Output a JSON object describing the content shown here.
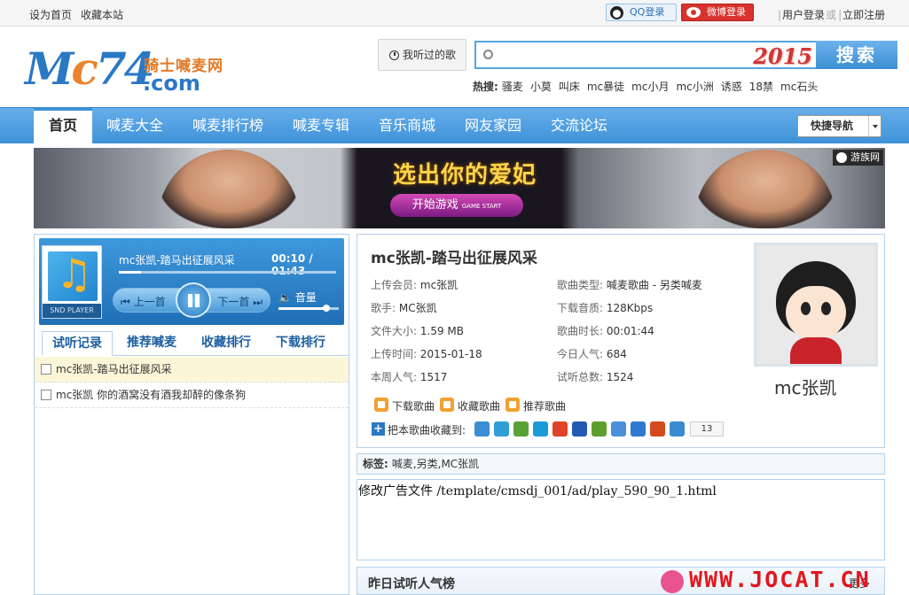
{
  "topbar": {
    "set_home": "设为首页",
    "bookmark": "收藏本站",
    "qq_login": "QQ登录",
    "weibo_login": "微博登录",
    "user_login": "用户登录",
    "separator": "或",
    "register": "立即注册"
  },
  "logo": {
    "main": "Mc74",
    "cn_name": "骑士喊麦网",
    "domain": ".com"
  },
  "header": {
    "listened_label": "我听过的歌",
    "search_placeholder": "",
    "search_badge": "2015",
    "search_button": "搜索",
    "hot_label": "热搜:",
    "hot_keywords": [
      "骚麦",
      "小莫",
      "叫床",
      "mc暴徒",
      "mc小月",
      "mc小洲",
      "诱惑",
      "18禁",
      "mc石头"
    ]
  },
  "nav": {
    "items": [
      "首页",
      "喊麦大全",
      "喊麦排行榜",
      "喊麦专辑",
      "音乐商城",
      "网友家园",
      "交流论坛"
    ],
    "active_index": 0,
    "quick_nav": "快捷导航"
  },
  "banner": {
    "headline": "选出你的爱妃",
    "cta": "开始游戏",
    "cta_small": "GAME START",
    "tag": "游族网"
  },
  "player": {
    "cover_label": "SND PLAYER",
    "now_playing": "mc张凯-踏马出征展风采",
    "current_time": "00:10",
    "total_time": "01:43",
    "progress": 0.1,
    "prev_label": "上一首",
    "next_label": "下一首",
    "volume_label": "音量",
    "volume_level": 0.8
  },
  "tabs": {
    "items": [
      "试听记录",
      "推荐喊麦",
      "收藏排行",
      "下载排行"
    ],
    "active_index": 0
  },
  "playlist": [
    {
      "title": "mc张凯-踏马出征展风采",
      "selected": true
    },
    {
      "title": "mc张凯 你的酒窝没有酒我却醉的像条狗",
      "selected": false
    }
  ],
  "song": {
    "title": "mc张凯-踏马出征展风采",
    "fields": [
      {
        "label": "上传会员:",
        "value": "mc张凯"
      },
      {
        "label": "歌曲类型:",
        "value": "喊麦歌曲 - 另类喊麦"
      },
      {
        "label": "歌手:",
        "value": "MC张凯"
      },
      {
        "label": "下载音质:",
        "value": "128Kbps"
      },
      {
        "label": "文件大小:",
        "value": "1.59 MB"
      },
      {
        "label": "歌曲时长:",
        "value": "00:01:44"
      },
      {
        "label": "上传时间:",
        "value": "2015-01-18"
      },
      {
        "label": "今日人气:",
        "value": "684"
      },
      {
        "label": "本周人气:",
        "value": "1517"
      },
      {
        "label": "试听总数:",
        "value": "1524"
      }
    ],
    "actions": [
      "下载歌曲",
      "收藏歌曲",
      "推荐歌曲"
    ],
    "share_label": "把本歌曲收藏到:",
    "share_count": "13",
    "share_colors": [
      "#3b8ed3",
      "#2f9fd6",
      "#5aa236",
      "#1c9ad6",
      "#e0432a",
      "#2259b3",
      "#5e9e2f",
      "#4a8fd8",
      "#2f7ad0",
      "#d34a1e",
      "#3a8bd0"
    ],
    "singer_name": "mc张凯"
  },
  "tags": {
    "label": "标签:",
    "value": "喊麦,另类,MC张凯"
  },
  "ad_placeholder": "修改广告文件 /template/cmsdj_001/ad/play_590_90_1.html",
  "popular": {
    "title": "昨日试听人气榜",
    "more": "更多"
  },
  "watermark": "WWW.JOCAT.CN"
}
